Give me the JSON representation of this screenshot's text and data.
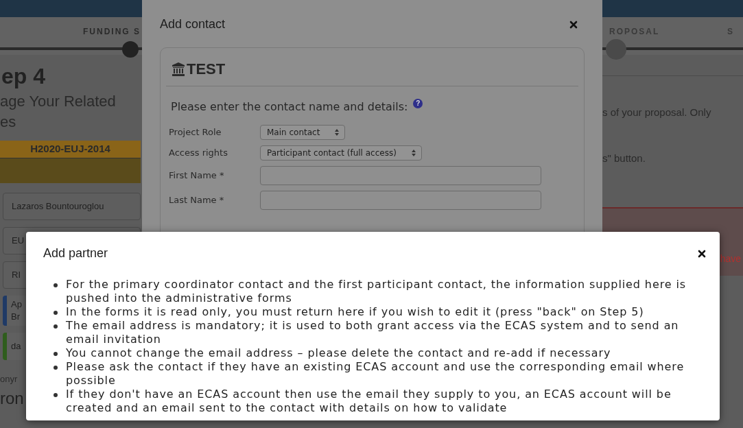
{
  "background_page": {
    "progress_steps": [
      {
        "label": "FUNDING S"
      },
      {
        "label": "ROPOSAL"
      },
      {
        "label": "S"
      }
    ],
    "heading": "ep 4",
    "subheading_lines": [
      "age Your Related",
      "es"
    ],
    "call_id": "H2020-EUJ-2014",
    "contact_buttons": [
      "Lazaros Bountouroglou",
      "EU",
      "RI"
    ],
    "org_lines": [
      "Ap",
      "Br"
    ],
    "green_item": "da",
    "bottom_texts": [
      "onyr",
      "ron"
    ],
    "intro_lines": [
      "s of your proposal. Only",
      "s\" button."
    ],
    "warning_text": "have"
  },
  "add_contact_dialog": {
    "title": "Add contact",
    "organisation": "TEST",
    "prompt": "Please enter the contact name and details:",
    "help_mark": "?",
    "fields": [
      {
        "kind": "select",
        "label": "Project Role",
        "value": "Main contact"
      },
      {
        "kind": "select",
        "label": "Access rights",
        "value": "Participant contact (full access)"
      },
      {
        "kind": "text",
        "label": "First Name *"
      },
      {
        "kind": "text",
        "label": "Last Name *"
      }
    ]
  },
  "add_partner_dialog": {
    "title": "Add partner",
    "bullets": [
      "For the primary coordinator contact and the first participant contact, the information supplied here is pushed into the administrative forms",
      "In the forms it is read only, you must return here if you wish to edit it (press \"back\" on Step 5)",
      "The email address is mandatory; it is used to both grant access via the ECAS system and to send an email invitation",
      "You cannot change the email address – please delete the contact and re-add if necessary",
      "Please ask the contact if they have an existing ECAS account and use the corresponding email where possible",
      "If they don't have an ECAS account then use the email they supply to you, an ECAS account will be created and an email sent to the contact with details on how to validate"
    ]
  }
}
